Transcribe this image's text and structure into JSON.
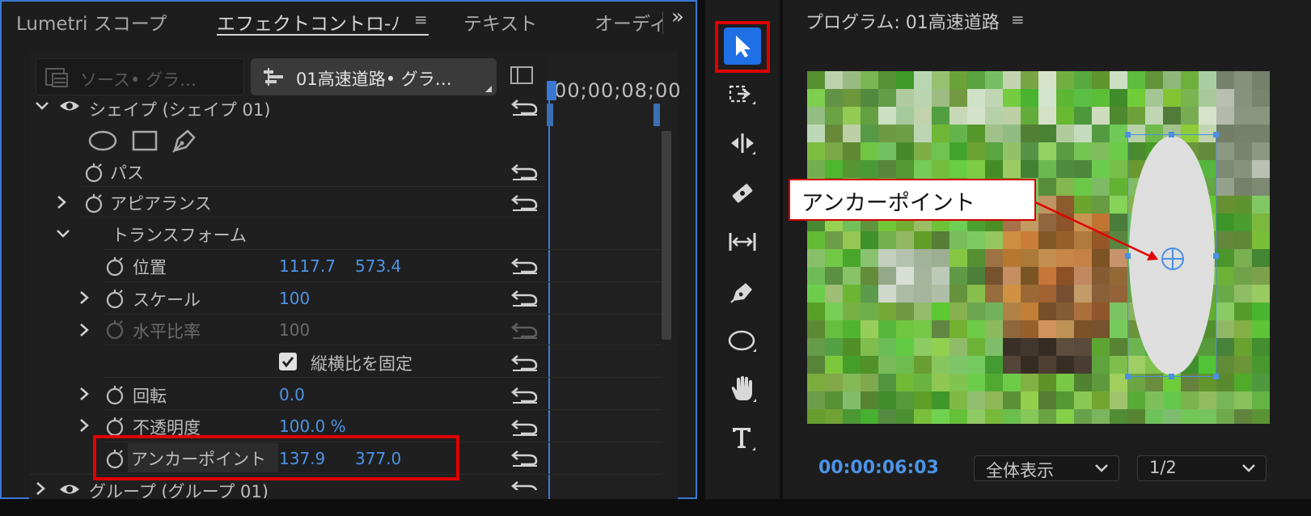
{
  "tabs": {
    "lumetri": "Lumetri スコープ",
    "effect_controls": "エフェクトコントロ-ﾉ",
    "effect_controls_menu": "≡",
    "text": "テキスト",
    "audio": "オーディ",
    "overflow": "»"
  },
  "source_selector": {
    "label": "ソース• グラ…"
  },
  "clip_selector": {
    "label": "01高速道路• グラ…"
  },
  "timeline": {
    "timecode": ":00;00;08;00"
  },
  "shape_group": {
    "label": "シェイプ (シェイプ 01)",
    "path_label": "パス",
    "appearance_label": "アピアランス",
    "transform_label": "トランスフォーム",
    "position_label": "位置",
    "position_x": "1117.7",
    "position_y": "573.4",
    "scale_label": "スケール",
    "scale_value": "100",
    "h_scale_label": "水平比率",
    "h_scale_value": "100",
    "uniform_scale_label": "縦横比を固定",
    "rotation_label": "回転",
    "rotation_value": "0.0",
    "opacity_label": "不透明度",
    "opacity_value": "100.0 %",
    "anchor_label": "アンカーポイント",
    "anchor_x": "137.9",
    "anchor_y": "377.0"
  },
  "group_row": {
    "label": "グループ (グループ 01)"
  },
  "program": {
    "title": "プログラム: 01高速道路",
    "menu": "≡",
    "timecode": "00:00:06:03",
    "zoom": "全体表示",
    "resolution": "1/2"
  },
  "callout": {
    "text": "アンカーポイント"
  },
  "colors": {
    "accent": "#3a78d4",
    "value_blue": "#4c93e6",
    "highlight_red": "#e00000",
    "tool_selected": "#1f6fe5"
  },
  "tools": [
    "selection-icon",
    "track-select-icon",
    "ripple-edit-icon",
    "razor-icon",
    "slip-icon",
    "pen-icon",
    "ellipse-icon",
    "hand-icon",
    "type-icon"
  ]
}
